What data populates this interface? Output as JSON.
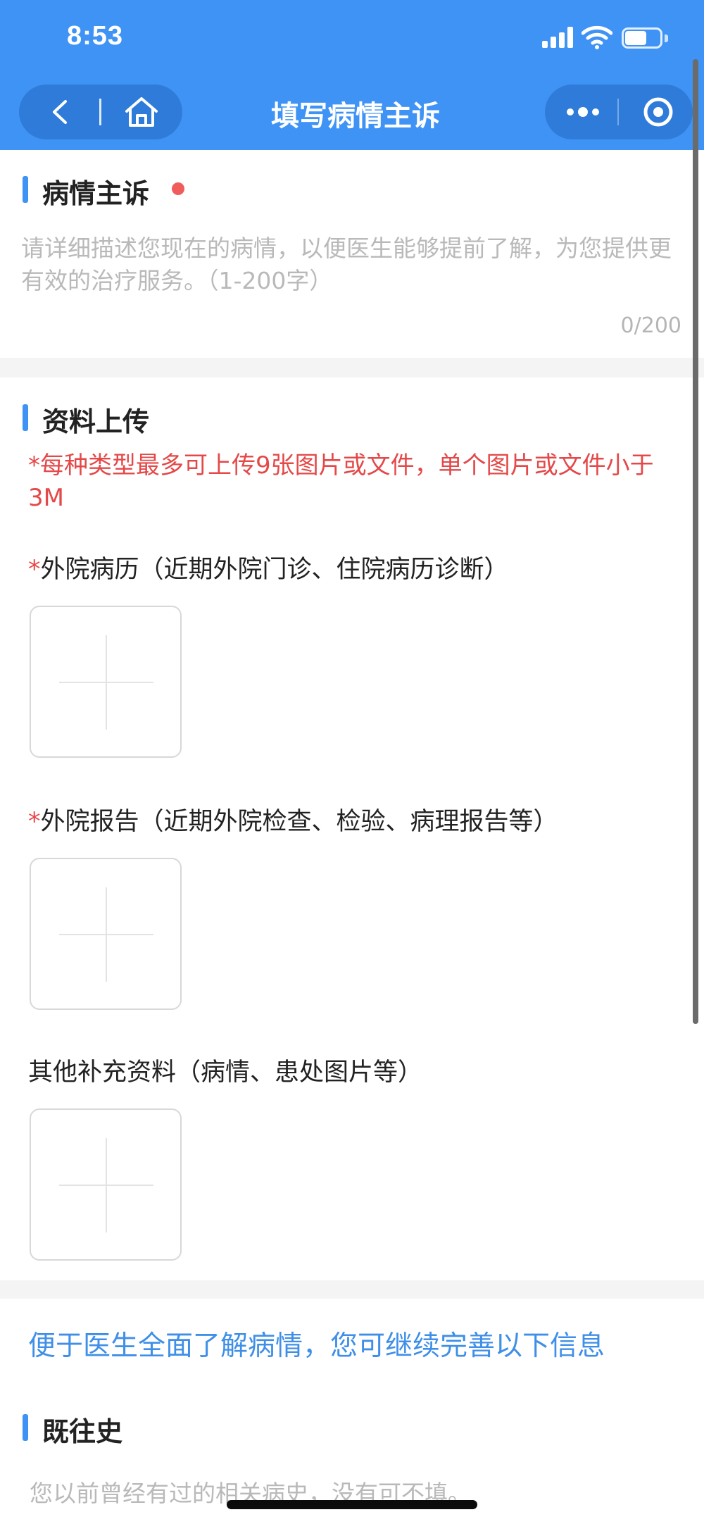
{
  "status_bar": {
    "time": "8:53"
  },
  "nav": {
    "title": "填写病情主诉"
  },
  "complaint": {
    "title": "病情主诉",
    "placeholder": "请详细描述您现在的病情，以便医生能够提前了解，为您提供更有效的治疗服务。（1-200字）",
    "value": "",
    "counter": "0/200"
  },
  "upload": {
    "title": "资料上传",
    "notice": "*每种类型最多可上传9张图片或文件，单个图片或文件小于3M",
    "required_mark": "*",
    "groups": [
      {
        "label": "外院病历（近期外院门诊、住院病历诊断）",
        "required": true
      },
      {
        "label": "外院报告（近期外院检查、检验、病理报告等）",
        "required": true
      },
      {
        "label": "其他补充资料（病情、患处图片等）",
        "required": false
      }
    ]
  },
  "more_info": "便于医生全面了解病情，您可继续完善以下信息",
  "history": {
    "title": "既往史",
    "placeholder": "您以前曾经有过的相关病史，没有可不填。",
    "value": ""
  },
  "colors": {
    "primary": "#3f93f5",
    "required_red": "#e54848",
    "link_blue": "#3f8fe8",
    "placeholder_gray": "#b9b9b9"
  },
  "icons": [
    "back-icon",
    "home-icon",
    "more-icon",
    "close-capsule-icon",
    "plus-icon"
  ]
}
